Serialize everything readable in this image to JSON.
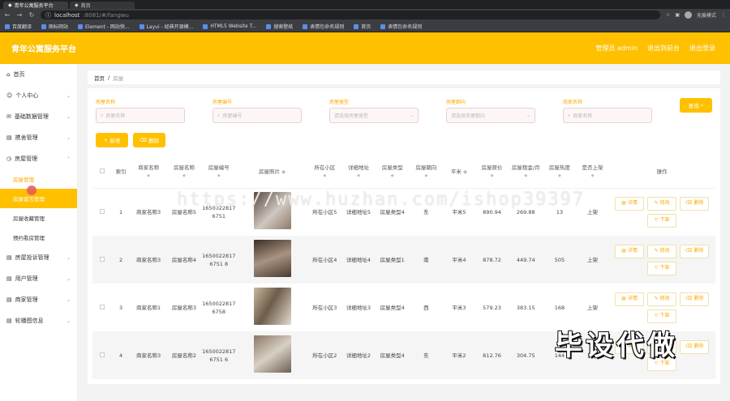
{
  "browser": {
    "tabs": [
      {
        "label": "青年公寓服务平台",
        "active": true
      },
      {
        "label": "首页",
        "active": false
      }
    ],
    "url_host": "localhost",
    "url_path": ":8081/#/fangwu",
    "profile_label": "无痕模式",
    "bookmarks": [
      "百度翻译",
      "图标网站",
      "Element - 网站快...",
      "Layui - 经典开源模...",
      "HTML5 Website T...",
      "搜索壁纸",
      "表情包命名规则",
      "首页",
      "表情包命名规则"
    ]
  },
  "header": {
    "title": "青年公寓服务平台",
    "links": [
      "管理员 admin",
      "退出到前台",
      "退出登录"
    ]
  },
  "sidebar": {
    "items": [
      {
        "label": "首页",
        "icon": "home-icon"
      },
      {
        "label": "个人中心",
        "icon": "user-icon",
        "chevron": true
      },
      {
        "label": "基础数据管理",
        "icon": "mail-icon",
        "chevron": true
      },
      {
        "label": "携舍管理",
        "icon": "doc-icon",
        "chevron": true
      },
      {
        "label": "房屋管理",
        "icon": "clock-icon",
        "chevron": true,
        "expanded": true
      }
    ],
    "subitems": [
      "房屋管理",
      "房屋留言管理",
      "房屋收藏管理",
      "预约看房管理"
    ],
    "items_after": [
      {
        "label": "房屋投诉管理",
        "icon": "doc-icon"
      },
      {
        "label": "用户管理",
        "icon": "doc-icon"
      },
      {
        "label": "商家管理",
        "icon": "doc-icon"
      },
      {
        "label": "轮播图信息",
        "icon": "doc-icon"
      }
    ]
  },
  "breadcrumb": {
    "home": "首页",
    "sep": "/",
    "current": "房屋"
  },
  "filters": [
    {
      "label": "房屋名称",
      "placeholder": "房屋名称",
      "type": "input"
    },
    {
      "label": "房屋编号",
      "placeholder": "房屋编号",
      "type": "input"
    },
    {
      "label": "房屋类型",
      "placeholder": "请选择房屋类型",
      "type": "select"
    },
    {
      "label": "房屋朝向",
      "placeholder": "请选择房屋朝向",
      "type": "select"
    },
    {
      "label": "商家名称",
      "placeholder": "商家名称",
      "type": "input"
    }
  ],
  "buttons": {
    "search": "查询",
    "add": "新增",
    "delete": "删除"
  },
  "table": {
    "headers": [
      "索引",
      "商家名称",
      "房屋名称",
      "房屋编号",
      "房屋照片",
      "所在小区",
      "详细地址",
      "房屋类型",
      "房屋朝向",
      "平米",
      "房屋原价",
      "房屋租金/月",
      "房屋热度",
      "是否上架",
      "操作"
    ],
    "rows": [
      {
        "index": "1",
        "shop": "商家名称3",
        "name": "房屋名称5",
        "code": "16500228176751",
        "community": "所在小区5",
        "address": "详细地址5",
        "type": "房屋类型4",
        "orient": "东",
        "area": "平米5",
        "price": "890.94",
        "rent": "269.88",
        "heat": "13",
        "status": "上架",
        "photo": [
          "#5a4a3e",
          "#cfc7bf"
        ]
      },
      {
        "index": "2",
        "shop": "商家名称3",
        "name": "房屋名称4",
        "code": "16500228176751 8",
        "community": "所在小区4",
        "address": "详细地址4",
        "type": "房屋类型1",
        "orient": "南",
        "area": "平米4",
        "price": "878.72",
        "rent": "449.74",
        "heat": "505",
        "status": "上架",
        "photo": [
          "#3b2e26",
          "#a99382"
        ]
      },
      {
        "index": "3",
        "shop": "商家名称1",
        "name": "房屋名称3",
        "code": "16500228176758",
        "community": "所在小区3",
        "address": "详细地址3",
        "type": "房屋类型4",
        "orient": "西",
        "area": "平米3",
        "price": "579.23",
        "rent": "383.15",
        "heat": "168",
        "status": "上架",
        "photo": [
          "#c9b9a0",
          "#6d5c4a"
        ]
      },
      {
        "index": "4",
        "shop": "商家名称3",
        "name": "房屋名称2",
        "code": "16500228176751 6",
        "community": "所在小区2",
        "address": "详细地址2",
        "type": "房屋类型4",
        "orient": "东",
        "area": "平米2",
        "price": "812.76",
        "rent": "304.75",
        "heat": "144",
        "status": "上架",
        "photo": [
          "#8a7766",
          "#d8d0c4"
        ]
      }
    ],
    "row_ops": [
      "详情",
      "修改",
      "删除",
      "下架"
    ]
  },
  "watermark": "https://www.huzhan.com/ishop39397",
  "stamp": "毕设代做",
  "colors": {
    "accent": "#ffc000",
    "link": "#ffa800"
  }
}
